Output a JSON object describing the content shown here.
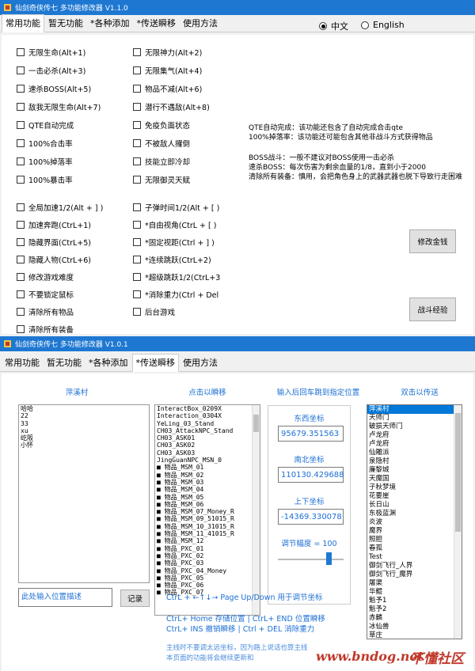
{
  "win1": {
    "title": "仙剑奇侠传七 多功能修改器 V1.1.0",
    "tabs": [
      "常用功能",
      "暂无功能",
      "*各种添加",
      "*传送瞬移",
      "使用方法"
    ],
    "lang": [
      "中文",
      "English"
    ],
    "col1": [
      "无限生命(Alt+1)",
      "一击必杀(Alt+3)",
      "速杀BOSS(Alt+5)",
      "敌我无限生命(Alt+7)",
      "QTE自动完成",
      "100%合击率",
      "100%掉落率",
      "100%暴击率",
      "全局加速1/2(Alt + ] )",
      "加速奔跑(CtrL+1)",
      "隐藏界面(CtrL+5)",
      "隐藏人物(CtrL+6)",
      "修改游戏难度",
      "不要锁定鼠标",
      "清除所有物品",
      "清除所有装备"
    ],
    "col2": [
      "无限神力(Alt+2)",
      "无限集气(Alt+4)",
      "物品不减(Alt+6)",
      "潜行不遇敌(Alt+8)",
      "免疫负面状态",
      "不被敌人攞倒",
      "技能立即冷却",
      "无限御灵天赋",
      "子弹时间1/2(Alt + [ )",
      "*自由视角(CtrL + [ )",
      "*固定视距(Ctrl + ] )",
      "*连续跳跃(CtrL+2)",
      "*超级跳跃1/2(CtrL+3",
      "*消除重力(Ctrl + Del",
      "后台游戏"
    ],
    "info": [
      "QTE自动完成：该功能还包含了自动完成合击qte",
      "100%掉落率：该功能还可能包含其他非战斗方式获得物品",
      "BOSS战斗：一般不建议对BOSS使用一击必杀",
      "速杀BOSS：每次伤害为剩余血量的1/8，直到小于2000",
      "清除所有装备：慎用，会把角色身上的武器武器也脱下导致行走困难"
    ],
    "btn_money": "修改金钱",
    "btn_exp": "战斗经验"
  },
  "win2": {
    "title": "仙剑奇侠传七 多功能修改器 V1.0.1",
    "tabs": [
      "常用功能",
      "暂无功能",
      "*各种添加",
      "*传送瞬移",
      "使用方法"
    ],
    "h1": "萍溪村",
    "h2": "点击以瞬移",
    "h3": "输入后回车跳到指定位置",
    "h4": "双击以传送",
    "left_list": [
      "哈哈",
      "22",
      "33",
      "xu",
      "屹阪",
      "小怀"
    ],
    "mid_list": [
      "InteractBox_0209X",
      "Interaction_0304X",
      "YeLing_03_Stand",
      "CH03_AttackNPC_Stand",
      "CH03_ASK01",
      "CH03_ASK02",
      "CH03_ASK03",
      "JingGuanNPC_MSN_0",
      "■ 物品_MSM_01",
      "■ 物品_MSM_02",
      "■ 物品_MSM_03",
      "■ 物品_MSM_04",
      "■ 物品_MSM_05",
      "■ 物品_MSM_06",
      "■ 物品_MSM_07_Money_R",
      "■ 物品_MSM_09_51015_R",
      "■ 物品_MSM_10_31015_R",
      "■ 物品_MSM_11_41015_R",
      "■ 物品_MSM_12",
      "■ 物品_PXC_01",
      "■ 物品_PXC_02",
      "■ 物品_PXC_03",
      "■ 物品_PXC_04_Money",
      "■ 物品_PXC_05",
      "■ 物品_PXC_06",
      "■ 物品_PXC_07"
    ],
    "ew_label": "东西坐标",
    "ew": "95679.351563",
    "ns_label": "南北坐标",
    "ns": "110130.429688",
    "ud_label": "上下坐标",
    "ud": "-14369.330078",
    "step_label": "调节幅度 = 100",
    "right_list": [
      "萍溪村",
      "天师门",
      "破损天师门",
      "卢龙府",
      "卢龙府",
      "仙雕派",
      "泉隐村",
      "廉黎城",
      "天魔国",
      "子秋梦境",
      "花要崖",
      "长日山",
      "东极蓝渊",
      "炎波",
      "魔界",
      "照胆",
      "春孤",
      "Test",
      "御剑飞行_人界",
      "御剑飞行_魔界",
      "屠渠",
      "华鲲",
      "魁予1",
      "魁予2",
      "赤麟",
      "冰仙兽",
      "草庄"
    ],
    "desc_placeholder": "此处输入位置描述",
    "btn_record": "记录",
    "hint1": "CtrL + ←↑↓→  Page Up/Down 用于调节坐标",
    "hint2": "CtrL+ Home 存储位置  |  CtrL+ END  位置瞬移",
    "hint3": "CtrL+ INS    撤销瞬移  |  Ctrl + DEL  消除重力",
    "hint4": "主线时不要调太远坐标，因为路上说话也算主线",
    "hint5": "本页面的功能将会继续更新和",
    "wm1": "www.bndog.net",
    "wm2": "不懂社区"
  },
  "colors": {
    "titlebar": "#1e78d2",
    "accent": "#1c6fd4",
    "select": "#0078d7"
  }
}
